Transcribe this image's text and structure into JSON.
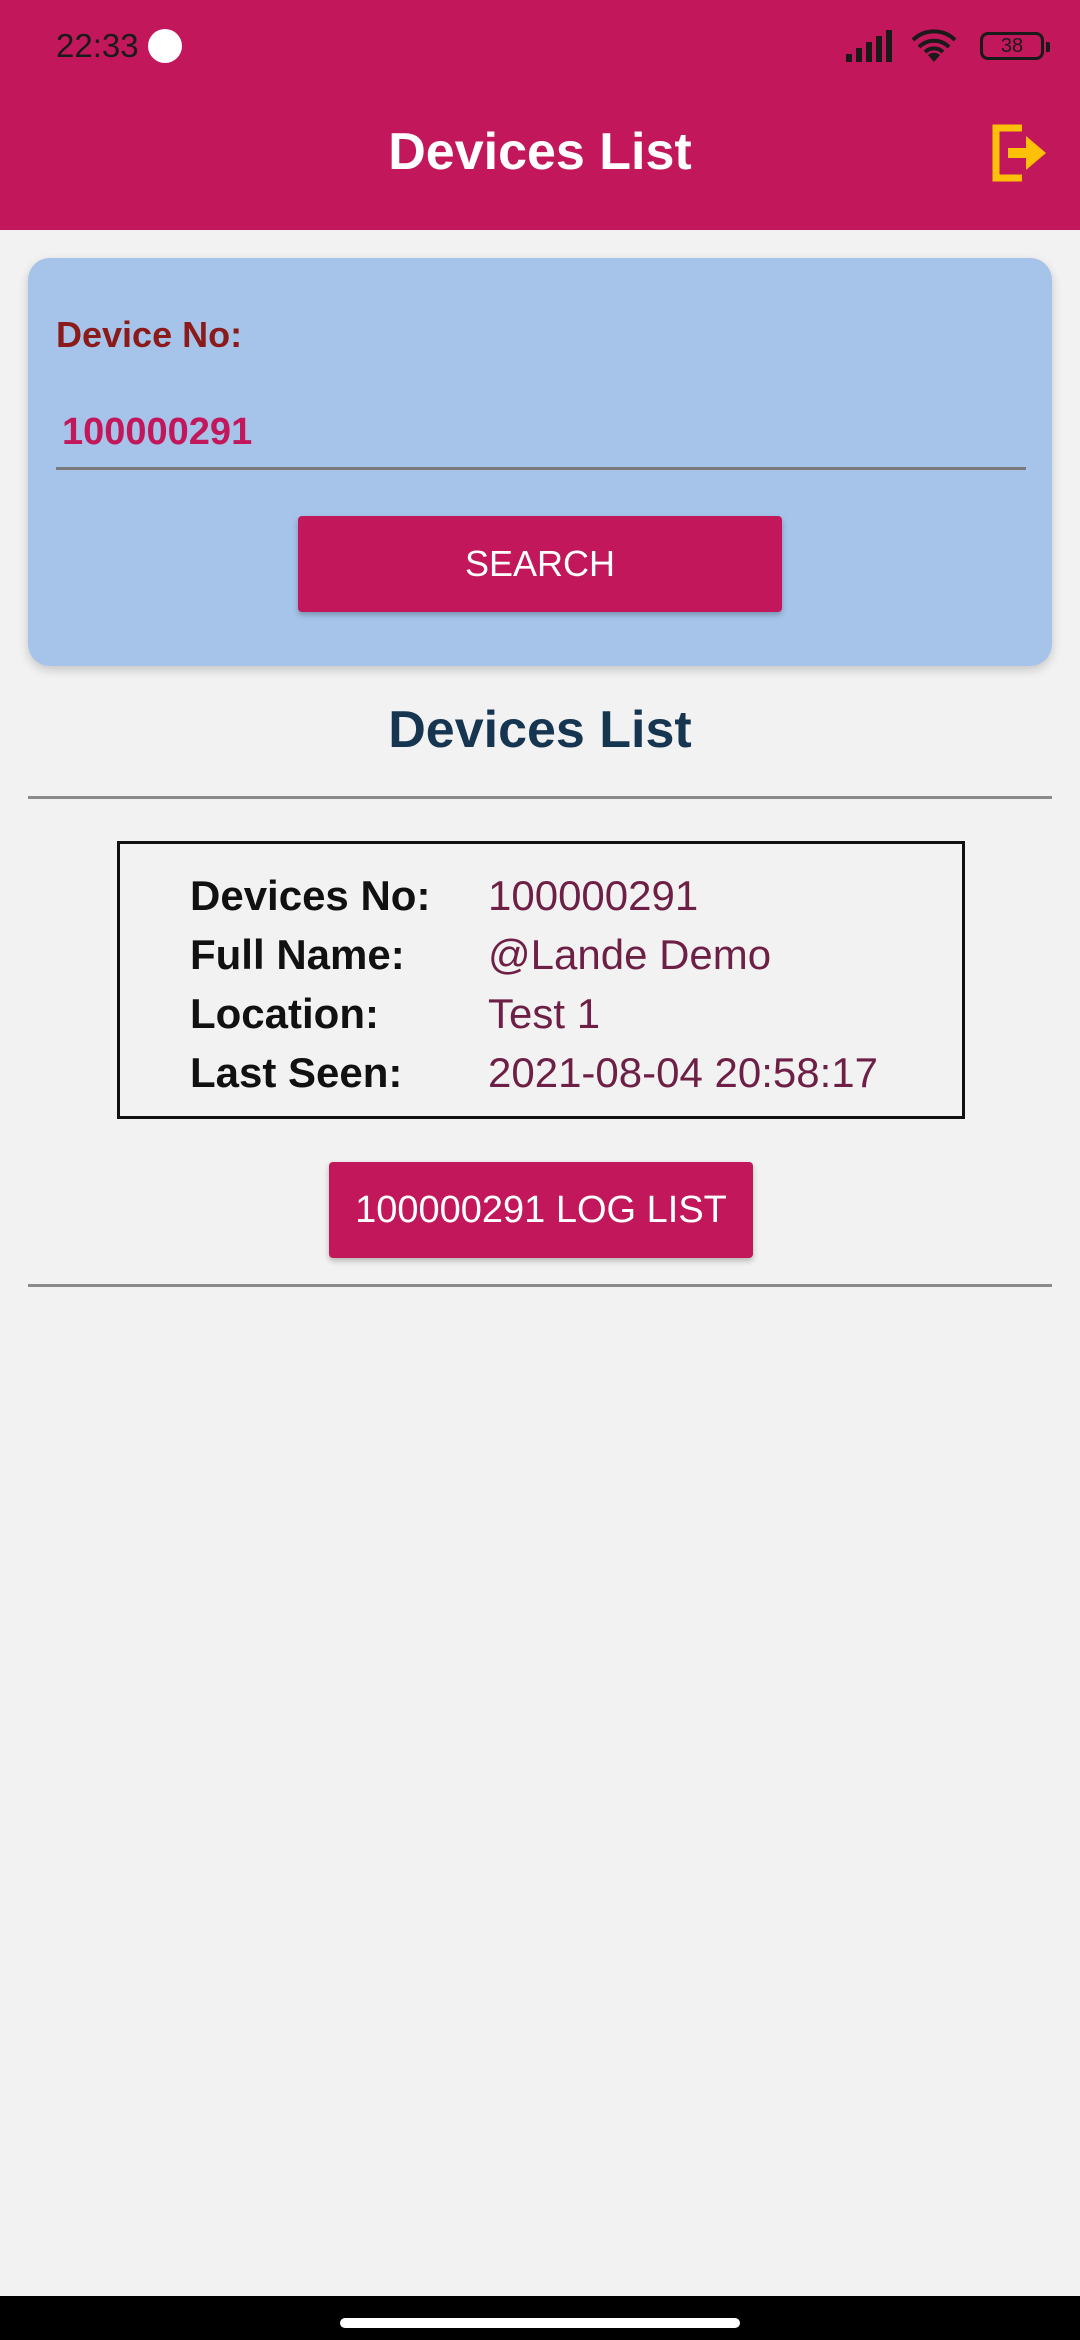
{
  "status_bar": {
    "time": "22:33",
    "battery": "38"
  },
  "app_bar": {
    "title": "Devices List",
    "logout_icon": "logout-icon",
    "background": "#c2185b",
    "icon_color": "#ffc107"
  },
  "search": {
    "label": "Device No:",
    "value": "100000291",
    "button_label": "SEARCH"
  },
  "list": {
    "title": "Devices List",
    "device": {
      "rows": [
        {
          "label": "Devices No:",
          "value": "100000291"
        },
        {
          "label": "Full Name:",
          "value": "@Lande Demo"
        },
        {
          "label": "Location:",
          "value": "Test 1"
        },
        {
          "label": "Last Seen:",
          "value": "2021-08-04 20:58:17"
        }
      ],
      "log_button_label": "100000291 LOG LIST"
    }
  }
}
